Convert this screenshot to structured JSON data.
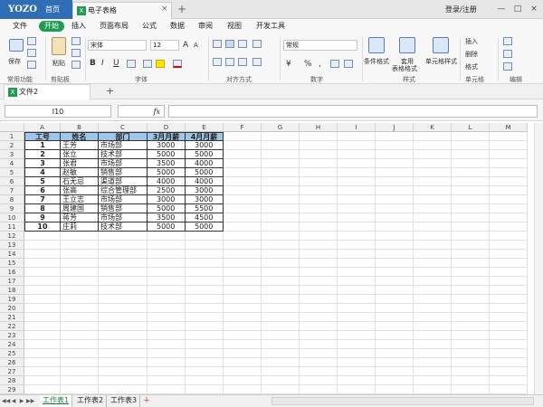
{
  "titlebar": {
    "logo": "YOZO",
    "home": "首页",
    "doc_title": "电子表格",
    "close": "×",
    "add": "+",
    "login": "登录/注册",
    "win_buttons": [
      "—",
      "□",
      "×"
    ]
  },
  "menubar": [
    "文件",
    "开始",
    "插入",
    "页面布局",
    "公式",
    "数据",
    "审阅",
    "视图",
    "开发工具"
  ],
  "ribbon": {
    "save": "保存",
    "common": "常用功能",
    "paste": "粘贴",
    "clipboard": "剪贴板",
    "font_name": "宋体",
    "font_size": "12",
    "grow": "A",
    "shrink": "A",
    "bold": "B",
    "italic": "I",
    "underline": "U",
    "font_group": "字体",
    "align_group": "对齐方式",
    "num_format": "常规",
    "currency": "¥",
    "percent": "%",
    "comma": ",",
    "number_group": "数字",
    "cond_format": "条件格式",
    "table_format_1": "套用",
    "table_format_2": "表格格式",
    "cell_style": "单元格样式",
    "style_group": "样式",
    "insert": "插入",
    "delete": "删除",
    "format": "格式",
    "cells_group": "单元格",
    "edit_group": "编辑"
  },
  "docbar": {
    "file_tab": "文件2",
    "add": "+"
  },
  "formula": {
    "namebox": "I10",
    "fx": "fx",
    "value": ""
  },
  "columns": [
    "A",
    "B",
    "C",
    "D",
    "E",
    "F",
    "G",
    "H",
    "I",
    "J",
    "K",
    "L",
    "M"
  ],
  "rows": [
    "1",
    "2",
    "3",
    "4",
    "5",
    "6",
    "7",
    "8",
    "9",
    "10",
    "11",
    "12",
    "13",
    "14",
    "15",
    "16",
    "17",
    "18",
    "19",
    "20",
    "21",
    "22",
    "23",
    "24",
    "25",
    "26",
    "27",
    "28",
    "29"
  ],
  "table": {
    "headers": [
      "工号",
      "姓名",
      "部门",
      "3月月薪",
      "4月月薪"
    ],
    "rows": [
      [
        "1",
        "王芳",
        "市场部",
        "3000",
        "3000"
      ],
      [
        "2",
        "张立",
        "技术部",
        "5000",
        "5000"
      ],
      [
        "3",
        "张君",
        "市场部",
        "3500",
        "4000"
      ],
      [
        "4",
        "赵敏",
        "销售部",
        "5000",
        "5000"
      ],
      [
        "5",
        "石无忌",
        "渠道部",
        "4000",
        "4000"
      ],
      [
        "6",
        "张高",
        "综合管理部",
        "2500",
        "3000"
      ],
      [
        "7",
        "王立志",
        "市场部",
        "3000",
        "3000"
      ],
      [
        "8",
        "周建国",
        "销售部",
        "5000",
        "5500"
      ],
      [
        "9",
        "蒋芳",
        "市场部",
        "3500",
        "4500"
      ],
      [
        "10",
        "庄莉",
        "技术部",
        "5000",
        "5000"
      ]
    ]
  },
  "sheets": [
    "工作表1",
    "工作表2",
    "工作表3"
  ],
  "sheet_nav": [
    "◀◀",
    "◀",
    "▶",
    "▶▶"
  ],
  "colors": {
    "accent": "#1e9c52",
    "brand": "#2f6db5",
    "header_fill": "#9ec6ea"
  }
}
